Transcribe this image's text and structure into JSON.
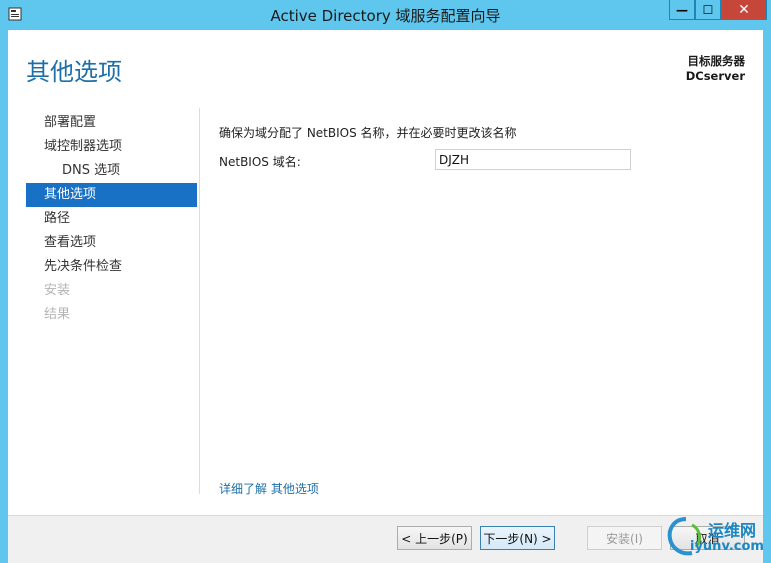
{
  "window": {
    "title": "Active Directory 域服务配置向导",
    "minimize_label": "—",
    "maximize_label": "☐",
    "close_label": "✕"
  },
  "header": {
    "page_title": "其他选项",
    "target_server_label": "目标服务器",
    "target_server_name": "DCserver"
  },
  "nav": {
    "items": [
      {
        "label": "部署配置"
      },
      {
        "label": "域控制器选项"
      },
      {
        "label": "DNS 选项"
      },
      {
        "label": "其他选项"
      },
      {
        "label": "路径"
      },
      {
        "label": "查看选项"
      },
      {
        "label": "先决条件检查"
      },
      {
        "label": "安装"
      },
      {
        "label": "结果"
      }
    ]
  },
  "main": {
    "description": "确保为域分配了 NetBIOS 名称，并在必要时更改该名称",
    "netbios_label": "NetBIOS 域名:",
    "netbios_value": "DJZH",
    "more_link": "详细了解 其他选项"
  },
  "footer": {
    "prev_label": "< 上一步(P)",
    "next_label": "下一步(N) >",
    "install_label": "安装(I)",
    "cancel_label": "取消"
  },
  "watermark": {
    "line1": "运维网",
    "line2": "iyunv.com"
  },
  "colors": {
    "titlebar": "#5fc6ee",
    "accent": "#1e6fa8",
    "nav_active": "#1871c4",
    "close_button": "#c7463a"
  }
}
